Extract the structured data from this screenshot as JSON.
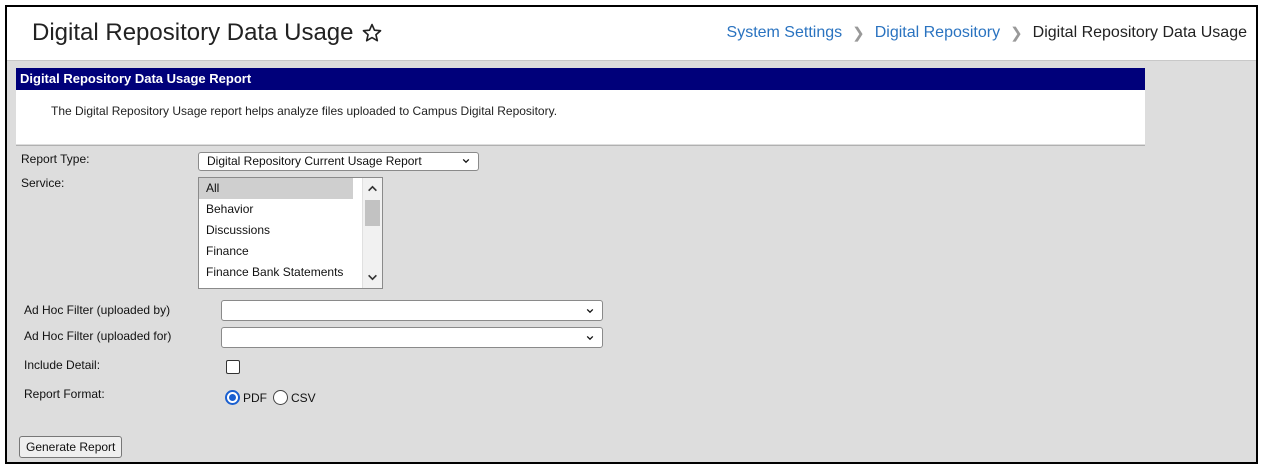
{
  "header": {
    "title": "Digital Repository Data Usage",
    "breadcrumbs": [
      "System Settings",
      "Digital Repository",
      "Digital Repository Data Usage"
    ]
  },
  "report": {
    "heading": "Digital Repository Data Usage Report",
    "description": "The Digital Repository Usage report helps analyze files uploaded to Campus Digital Repository."
  },
  "form": {
    "report_type_label": "Report Type:",
    "report_type_value": "Digital Repository Current Usage Report",
    "service_label": "Service:",
    "service_options": [
      "All",
      "Behavior",
      "Discussions",
      "Finance",
      "Finance Bank Statements"
    ],
    "adhoc_by_label": "Ad Hoc Filter (uploaded by)",
    "adhoc_by_value": "",
    "adhoc_for_label": "Ad Hoc Filter (uploaded for)",
    "adhoc_for_value": "",
    "include_detail_label": "Include Detail:",
    "include_detail_checked": false,
    "report_format_label": "Report Format:",
    "format_options": [
      "PDF",
      "CSV"
    ],
    "format_selected": "PDF",
    "generate_label": "Generate Report"
  },
  "colors": {
    "accent": "#2a73c0",
    "report_bar": "#00007a",
    "radio": "#1a5fd0",
    "panel_bg": "#dddddd"
  }
}
